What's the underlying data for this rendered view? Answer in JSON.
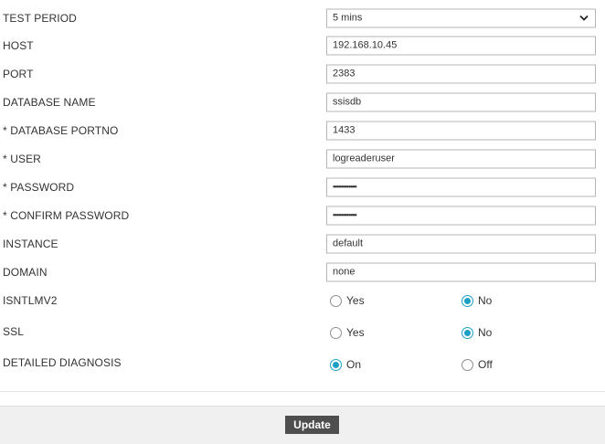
{
  "form": {
    "test_period": {
      "label": "TEST PERIOD",
      "value": "5 mins"
    },
    "host": {
      "label": "HOST",
      "value": "192.168.10.45"
    },
    "port": {
      "label": "PORT",
      "value": "2383"
    },
    "database_name": {
      "label": "DATABASE NAME",
      "value": "ssisdb"
    },
    "database_portno": {
      "label": "* DATABASE PORTNO",
      "value": "1433"
    },
    "user": {
      "label": "* USER",
      "value": "logreaderuser"
    },
    "password": {
      "label": "* PASSWORD",
      "value": "••••••••••••"
    },
    "confirm_password": {
      "label": "* CONFIRM PASSWORD",
      "value": "••••••••••••"
    },
    "instance": {
      "label": "INSTANCE",
      "value": "default"
    },
    "domain": {
      "label": "DOMAIN",
      "value": "none"
    },
    "isntlmv2": {
      "label": "ISNTLMV2",
      "option_a": "Yes",
      "option_b": "No",
      "selected": "No"
    },
    "ssl": {
      "label": "SSL",
      "option_a": "Yes",
      "option_b": "No",
      "selected": "No"
    },
    "detailed_diagnosis": {
      "label": "DETAILED DIAGNOSIS",
      "option_a": "On",
      "option_b": "Off",
      "selected": "On"
    }
  },
  "footer": {
    "update_label": "Update"
  },
  "colors": {
    "accent": "#1ea0c5",
    "button_bg": "#4e4e4e",
    "footer_bg": "#f0f0f0"
  }
}
